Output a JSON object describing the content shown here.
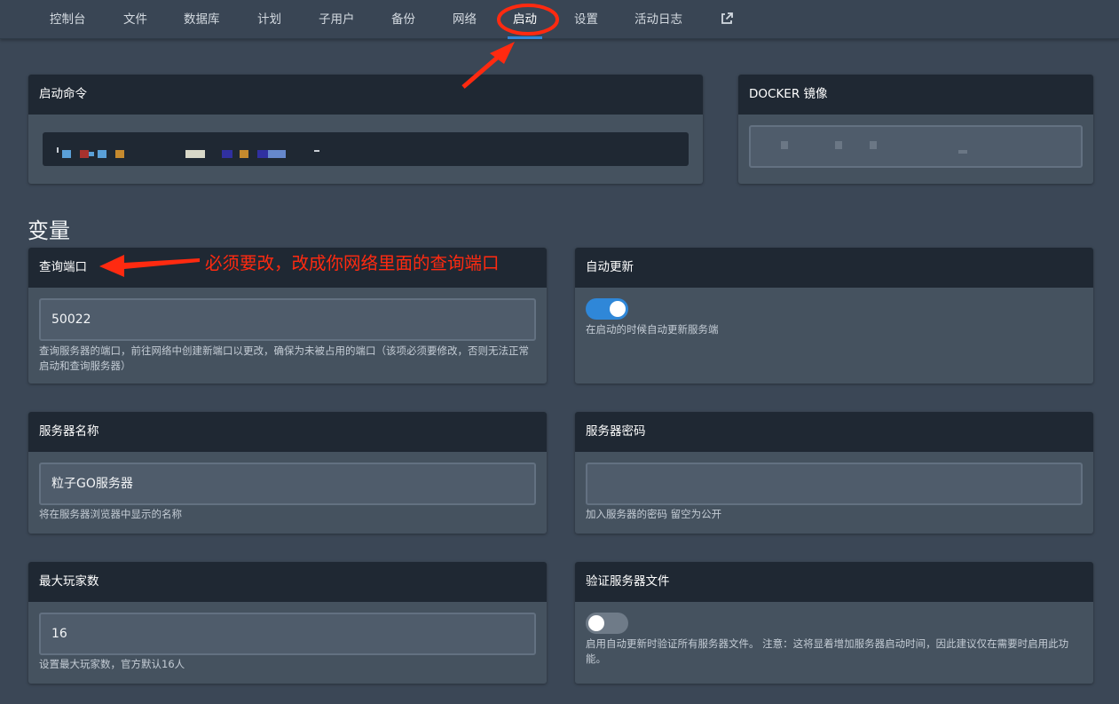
{
  "nav": {
    "items": [
      {
        "label": "控制台"
      },
      {
        "label": "文件"
      },
      {
        "label": "数据库"
      },
      {
        "label": "计划"
      },
      {
        "label": "子用户"
      },
      {
        "label": "备份"
      },
      {
        "label": "网络"
      },
      {
        "label": "启动",
        "active": true
      },
      {
        "label": "设置"
      },
      {
        "label": "活动日志"
      }
    ],
    "external_icon": "external-link-icon"
  },
  "startup": {
    "command_title": "启动命令",
    "docker_title": "DOCKER 镜像"
  },
  "variables": {
    "section_title": "变量",
    "query_port": {
      "title": "查询端口",
      "value": "50022",
      "hint": "查询服务器的端口，前往网络中创建新端口以更改，确保为未被占用的端口（该项必须要修改，否则无法正常启动和查询服务器）"
    },
    "auto_update": {
      "title": "自动更新",
      "enabled": true,
      "hint": "在启动的时候自动更新服务端"
    },
    "server_name": {
      "title": "服务器名称",
      "value": "粒子GO服务器",
      "hint": "将在服务器浏览器中显示的名称"
    },
    "server_password": {
      "title": "服务器密码",
      "value": "",
      "hint": "加入服务器的密码 留空为公开"
    },
    "max_players": {
      "title": "最大玩家数",
      "value": "16",
      "hint": "设置最大玩家数，官方默认16人"
    },
    "validate_files": {
      "title": "验证服务器文件",
      "enabled": false,
      "hint": "启用自动更新时验证所有服务器文件。 注意：这将显着增加服务器启动时间，因此建议仅在需要时启用此功能。"
    }
  },
  "annotations": {
    "note": "必须要改，改成你网络里面的查询端口",
    "color": "#ff2a10"
  },
  "colors": {
    "accent": "#2f87d8",
    "panel_head": "#1f2833",
    "panel_body": "#45525f",
    "background": "#3b4756"
  }
}
